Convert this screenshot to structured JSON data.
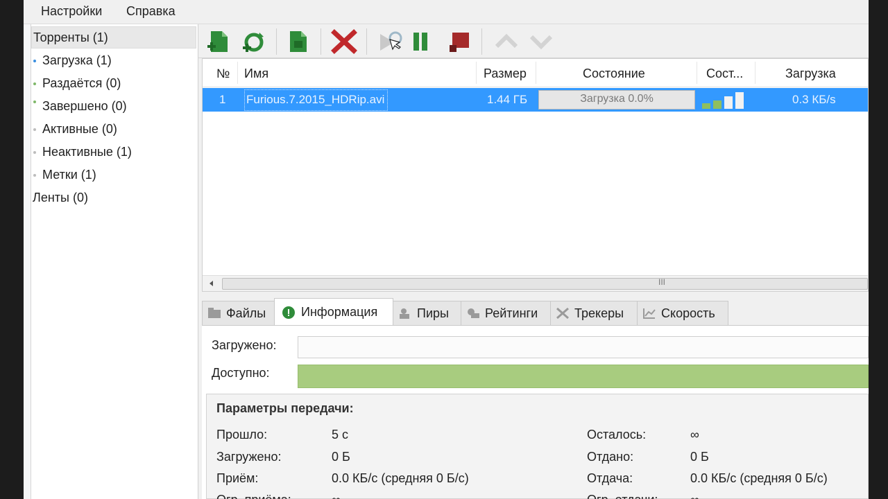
{
  "menubar": {
    "settings": "Настройки",
    "help": "Справка"
  },
  "sidebar": {
    "items": [
      {
        "label": "Торренты (1)"
      },
      {
        "label": "Загрузка (1)"
      },
      {
        "label": "Раздаётся (0)"
      },
      {
        "label": "Завершено (0)"
      },
      {
        "label": "Активные (0)"
      },
      {
        "label": "Неактивные (1)"
      },
      {
        "label": "Метки (1)"
      },
      {
        "label": "Ленты (0)"
      }
    ]
  },
  "toolbar": {
    "icons": [
      "add-torrent-icon",
      "add-link-icon",
      "create-torrent-icon",
      "remove-icon",
      "start-icon",
      "pause-icon",
      "stop-icon",
      "move-up-icon",
      "move-down-icon"
    ]
  },
  "list": {
    "columns": [
      "№",
      "Имя",
      "Размер",
      "Состояние",
      "Сост...",
      "Загрузка"
    ],
    "rows": [
      {
        "num": "1",
        "name": "Furious.7.2015_HDRip.avi",
        "size": "1.44 ГБ",
        "status": "Загрузка 0.0%",
        "progress": 0.0,
        "download": "0.3 КБ/s"
      }
    ],
    "scroll_grip": "III"
  },
  "tabs": [
    "Файлы",
    "Информация",
    "Пиры",
    "Рейтинги",
    "Трекеры",
    "Скорость"
  ],
  "info": {
    "downloaded_label": "Загружено:",
    "available_label": "Доступно:",
    "params_title": "Параметры передачи:",
    "left": [
      {
        "k": "Прошло:",
        "v": "5 с"
      },
      {
        "k": "Загружено:",
        "v": "0 Б"
      },
      {
        "k": "Приём:",
        "v": "0.0 КБ/с (средняя 0 Б/с)"
      },
      {
        "k": "Огр. приёма:",
        "v": "∞"
      }
    ],
    "right": [
      {
        "k": "Осталось:",
        "v": "∞"
      },
      {
        "k": "Отдано:",
        "v": "0 Б"
      },
      {
        "k": "Отдача:",
        "v": "0.0 КБ/с (средняя 0 Б/с)"
      },
      {
        "k": "Огр. отдачи:",
        "v": "∞"
      }
    ]
  },
  "colors": {
    "selection": "#3399ff",
    "available": "#a8cc7f",
    "remove": "#c0282b",
    "green": "#2f8c3a"
  }
}
